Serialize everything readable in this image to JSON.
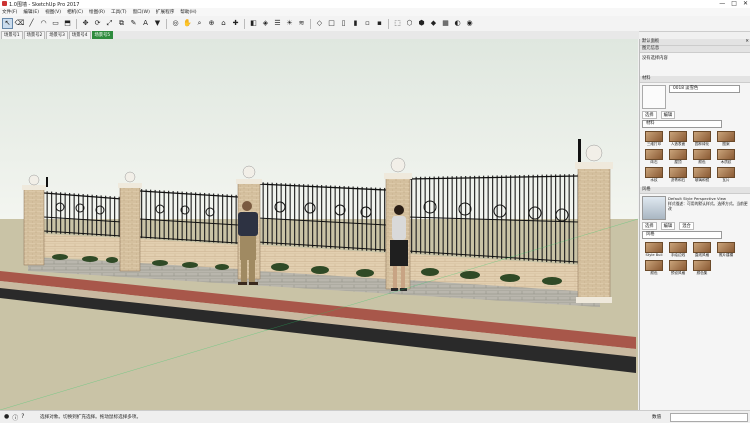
{
  "window": {
    "title": "1.0围墙 - SketchUp Pro 2017",
    "controls": [
      "—",
      "□",
      "✕"
    ]
  },
  "menu": [
    "文件(F)",
    "编辑(E)",
    "视图(V)",
    "相机(C)",
    "绘图(R)",
    "工具(T)",
    "窗口(W)",
    "扩展程序",
    "帮助(H)"
  ],
  "toolbar": [
    {
      "name": "select-tool",
      "glyph": "↖",
      "selected": true
    },
    {
      "name": "eraser-tool",
      "glyph": "⌫"
    },
    {
      "name": "line-tool",
      "glyph": "╱"
    },
    {
      "name": "arc-tool",
      "glyph": "◠"
    },
    {
      "name": "shape-tool",
      "glyph": "▭"
    },
    {
      "name": "push-pull-tool",
      "glyph": "⬒"
    },
    {
      "name": "move-tool",
      "glyph": "✥"
    },
    {
      "name": "rotate-tool",
      "glyph": "⟳"
    },
    {
      "name": "scale-tool",
      "glyph": "⤢"
    },
    {
      "name": "offset-tool",
      "glyph": "⧉"
    },
    {
      "name": "tape-tool",
      "glyph": "✎"
    },
    {
      "name": "text-tool",
      "glyph": "A"
    },
    {
      "name": "paint-bucket-tool",
      "glyph": "▼"
    },
    {
      "name": "orbit-tool",
      "glyph": "◎"
    },
    {
      "name": "pan-tool",
      "glyph": "✋"
    },
    {
      "name": "zoom-tool",
      "glyph": "⌕"
    },
    {
      "name": "zoom-extents-tool",
      "glyph": "⊕"
    },
    {
      "name": "warehouse-tool",
      "glyph": "⌂"
    },
    {
      "name": "extension-tool",
      "glyph": "✚"
    },
    {
      "name": "section-tool",
      "glyph": "◧"
    },
    {
      "name": "styles-tool",
      "glyph": "◈"
    },
    {
      "name": "layers-tool",
      "glyph": "☰"
    },
    {
      "name": "shadow-tool",
      "glyph": "☀"
    },
    {
      "name": "fog-tool",
      "glyph": "≋"
    },
    {
      "name": "iso-view",
      "glyph": "◇"
    },
    {
      "name": "top-view",
      "glyph": "□"
    },
    {
      "name": "front-view",
      "glyph": "▯"
    },
    {
      "name": "right-view",
      "glyph": "▮"
    },
    {
      "name": "back-view",
      "glyph": "▫"
    },
    {
      "name": "left-view",
      "glyph": "▪"
    },
    {
      "name": "xray-style",
      "glyph": "⬚"
    },
    {
      "name": "wireframe-style",
      "glyph": "⬡"
    },
    {
      "name": "hidden-line-style",
      "glyph": "⬢"
    },
    {
      "name": "shaded-style",
      "glyph": "◆"
    },
    {
      "name": "textured-style",
      "glyph": "▦"
    },
    {
      "name": "monochrome-style",
      "glyph": "◐"
    },
    {
      "name": "ruby-console",
      "glyph": "◉"
    }
  ],
  "scenes": [
    {
      "label": "场景号1",
      "active": false
    },
    {
      "label": "场景号2",
      "active": false
    },
    {
      "label": "场景号3",
      "active": false
    },
    {
      "label": "场景号4",
      "active": false
    },
    {
      "label": "场景号5",
      "active": true
    }
  ],
  "tray": {
    "title": "默认面板",
    "entity_info": {
      "header": "图元信息",
      "value": "没有选择内容"
    },
    "materials": {
      "header": "材料",
      "current": "0018 淡雪色",
      "tabs": [
        "选择",
        "编辑"
      ],
      "dropdown": "材料",
      "items": [
        "三维打印",
        "人造表面",
        "园林绿化",
        "图案",
        "砖石",
        "屋顶",
        "颜色",
        "木质纹",
        "水纹",
        "沥青和石",
        "玻璃和镜",
        "瓦片"
      ]
    },
    "styles": {
      "header": "风格",
      "name": "Default Style Perspective View",
      "desc": "样式描述：可用的默认样式。选择方式。当前更改",
      "tabs": [
        "选择",
        "编辑",
        "混合"
      ],
      "dropdown": "风格",
      "items": [
        "Style Buil",
        "手绘边线",
        "直线风格",
        "照片建模",
        "颜色",
        "预设风格",
        "颜色集"
      ]
    }
  },
  "status": {
    "message": "选择对象。切换到扩充选择。拖动鼠标选择多项。",
    "measurement_label": "数值"
  },
  "colors": {
    "accent": "#2e8b3d",
    "sky": "#e9efe7",
    "ground": "#c8c2a8"
  }
}
